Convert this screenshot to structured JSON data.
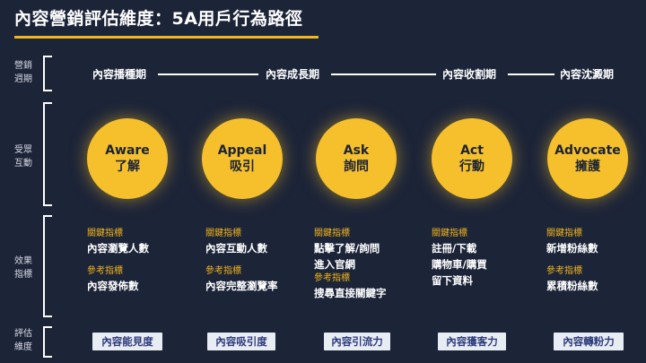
{
  "title": "內容營銷評估維度：5A用戶行為路徑",
  "rows": {
    "cycle": [
      "營銷",
      "週期"
    ],
    "interaction": [
      "受眾",
      "互動"
    ],
    "effect": [
      "效果",
      "指標"
    ],
    "evaluation": [
      "評估",
      "維度"
    ]
  },
  "stages": [
    "內容播種期",
    "內容成長期",
    "內容收割期",
    "內容沈澱期"
  ],
  "columns": [
    {
      "en": "Aware",
      "zh": "了解",
      "key_label": "關鍵指標",
      "key_items": [
        "內容瀏覽人數"
      ],
      "ref_label": "參考指標",
      "ref_items": [
        "內容發佈數"
      ],
      "eval": "內容能見度"
    },
    {
      "en": "Appeal",
      "zh": "吸引",
      "key_label": "關鍵指標",
      "key_items": [
        "內容互動人數"
      ],
      "ref_label": "參考指標",
      "ref_items": [
        "內容完整瀏覽率"
      ],
      "eval": "內容吸引度"
    },
    {
      "en": "Ask",
      "zh": "詢問",
      "key_label": "關鍵指標",
      "key_items": [
        "點擊了解/詢問",
        "進入官網"
      ],
      "ref_label": "參考指標",
      "ref_items": [
        "搜尋直接關鍵字"
      ],
      "eval": "內容引流力"
    },
    {
      "en": "Act",
      "zh": "行動",
      "key_label": "關鍵指標",
      "key_items": [
        "註冊/下載",
        "購物車/購買",
        "留下資料"
      ],
      "ref_label": "",
      "ref_items": [],
      "eval": "內容獲客力"
    },
    {
      "en": "Advocate",
      "zh": "擁護",
      "key_label": "關鍵指標",
      "key_items": [
        "新增粉絲數"
      ],
      "ref_label": "參考指標",
      "ref_items": [
        "累積粉絲數"
      ],
      "eval": "內容轉粉力"
    }
  ],
  "colors": {
    "background": "#1c2438",
    "accent": "#f3b51c",
    "circle": "#f5c02b",
    "eval_bg": "#e8ecf3",
    "eval_text": "#2c3b7a"
  }
}
